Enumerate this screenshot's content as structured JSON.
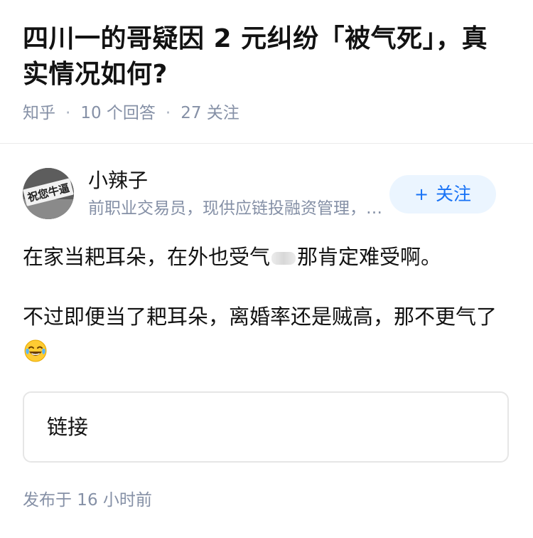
{
  "question": {
    "title": "四川一的哥疑因 2 元纠纷「被气死」，真实情况如何?",
    "source": "知乎",
    "answer_count": "10 个回答",
    "follower_count": "27 关注"
  },
  "author": {
    "name": "小辣子",
    "bio": "前职业交易员，现供应链投融资管理，金融研究方向",
    "follow_icon": "plus-icon",
    "follow_label": "关注",
    "avatar_text": "祝您牛逼"
  },
  "answer": {
    "line1_a": "在家当耙耳朵，在外也受气",
    "line1_b": "那肯定难受啊。",
    "line2": "不过即便当了耙耳朵，离婚率还是贼高，那不更气了",
    "emoji": "laughing-tears-emoji"
  },
  "link_card": {
    "label": "链接"
  },
  "footer": {
    "published": "发布于  16 小时前"
  },
  "colors": {
    "accent": "#1772f6",
    "follow_bg": "#ebf5ff",
    "meta": "#8590a6",
    "text": "#121212"
  }
}
